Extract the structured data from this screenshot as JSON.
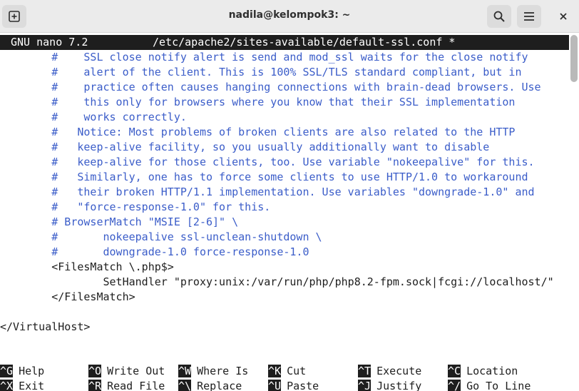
{
  "window": {
    "title": "nadila@kelompok3: ~"
  },
  "icons": {
    "new_tab": "new-tab-icon",
    "search": "search-icon",
    "menu": "hamburger-menu-icon",
    "close": "close-icon"
  },
  "nano": {
    "version": "GNU nano 7.2",
    "file": "/etc/apache2/sites-available/default-ssl.conf *"
  },
  "lines": [
    {
      "text": "        #    SSL close notify alert is send and mod_ssl waits for the close notify",
      "kind": "comment"
    },
    {
      "text": "        #    alert of the client. This is 100% SSL/TLS standard compliant, but in",
      "kind": "comment"
    },
    {
      "text": "        #    practice often causes hanging connections with brain-dead browsers. Use",
      "kind": "comment"
    },
    {
      "text": "        #    this only for browsers where you know that their SSL implementation",
      "kind": "comment"
    },
    {
      "text": "        #    works correctly.",
      "kind": "comment"
    },
    {
      "text": "        #   Notice: Most problems of broken clients are also related to the HTTP",
      "kind": "comment"
    },
    {
      "text": "        #   keep-alive facility, so you usually additionally want to disable",
      "kind": "comment"
    },
    {
      "text": "        #   keep-alive for those clients, too. Use variable \"nokeepalive\" for this.",
      "kind": "comment"
    },
    {
      "text": "        #   Similarly, one has to force some clients to use HTTP/1.0 to workaround",
      "kind": "comment"
    },
    {
      "text": "        #   their broken HTTP/1.1 implementation. Use variables \"downgrade-1.0\" and",
      "kind": "comment"
    },
    {
      "text": "        #   \"force-response-1.0\" for this.",
      "kind": "comment"
    },
    {
      "text": "        # BrowserMatch \"MSIE [2-6]\" \\",
      "kind": "comment"
    },
    {
      "text": "        #       nokeepalive ssl-unclean-shutdown \\",
      "kind": "comment"
    },
    {
      "text": "        #       downgrade-1.0 force-response-1.0",
      "kind": "comment"
    },
    {
      "text": "        <FilesMatch \\.php$>",
      "kind": "plain"
    },
    {
      "text": "                SetHandler \"proxy:unix:/var/run/php/php8.2-fpm.sock|fcgi://localhost/\"",
      "kind": "plain"
    },
    {
      "text": "        </FilesMatch>",
      "kind": "plain"
    },
    {
      "text": "",
      "kind": "plain"
    },
    {
      "text": "</VirtualHost>",
      "kind": "plain"
    }
  ],
  "shortcuts": [
    {
      "key": "^G",
      "label": "Help"
    },
    {
      "key": "^O",
      "label": "Write Out"
    },
    {
      "key": "^W",
      "label": "Where Is"
    },
    {
      "key": "^K",
      "label": "Cut"
    },
    {
      "key": "^T",
      "label": "Execute"
    },
    {
      "key": "^C",
      "label": "Location"
    },
    {
      "key": "^X",
      "label": "Exit"
    },
    {
      "key": "^R",
      "label": "Read File"
    },
    {
      "key": "^\\",
      "label": "Replace"
    },
    {
      "key": "^U",
      "label": "Paste"
    },
    {
      "key": "^J",
      "label": "Justify"
    },
    {
      "key": "^/",
      "label": "Go To Line"
    }
  ]
}
